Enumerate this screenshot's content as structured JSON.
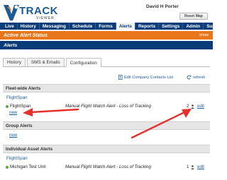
{
  "brand": {
    "logo_mark": "V2",
    "name": "TRACK",
    "sub": "VIEWER"
  },
  "header": {
    "user_name": "David H Porter",
    "reset_map": "Reset Map"
  },
  "nav": {
    "items": [
      {
        "label": "Live",
        "active": false
      },
      {
        "label": "History",
        "active": false
      },
      {
        "label": "Messaging",
        "active": false
      },
      {
        "label": "Schedule",
        "active": false
      },
      {
        "label": "Forms",
        "active": false
      },
      {
        "label": "Alerts",
        "active": true
      },
      {
        "label": "Reports",
        "active": false
      },
      {
        "label": "Settings",
        "active": false
      },
      {
        "label": "Admin",
        "active": false
      },
      {
        "label": "Support",
        "active": false
      }
    ]
  },
  "alert_status": {
    "title": "Active Alert Status",
    "show": "show"
  },
  "section": {
    "title": "Alerts"
  },
  "tabs": [
    {
      "label": "History",
      "active": false
    },
    {
      "label": "SMS & Emails",
      "active": false
    },
    {
      "label": "Configuration",
      "active": true
    }
  ],
  "actions": {
    "edit_contacts": "Edit Company Contacts List",
    "refresh": "refresh"
  },
  "fleet": {
    "header": "Fleet-wide Alerts",
    "subgroup": "FlightSpan",
    "row": {
      "asset": "FlightSpan",
      "alert": "Manual Flight Watch Alert - Loss of Tracking",
      "count": "2",
      "edit": "edit"
    },
    "new_link": "new"
  },
  "group": {
    "header": "Group Alerts",
    "new_link": "new"
  },
  "individual": {
    "header": "Individual Asset Alerts",
    "subgroup": "FlightSpan",
    "row": {
      "asset": "Michigan Test Unit",
      "alert": "Manual Flight Watch Alert - Loss of Tracking",
      "count": "1",
      "edit": "edit"
    }
  },
  "colors": {
    "nav_bg": "#0a3c7a",
    "alert_bar": "#e9761a",
    "link": "#1b5b96",
    "status_dot": "#5ca93a",
    "annotation_arrow": "#e8302a"
  },
  "icons": {
    "logo": "v2-logo-mark",
    "contacts": "address-book-icon",
    "refresh": "refresh-icon",
    "person": "person-icon",
    "status": "status-dot-icon"
  }
}
